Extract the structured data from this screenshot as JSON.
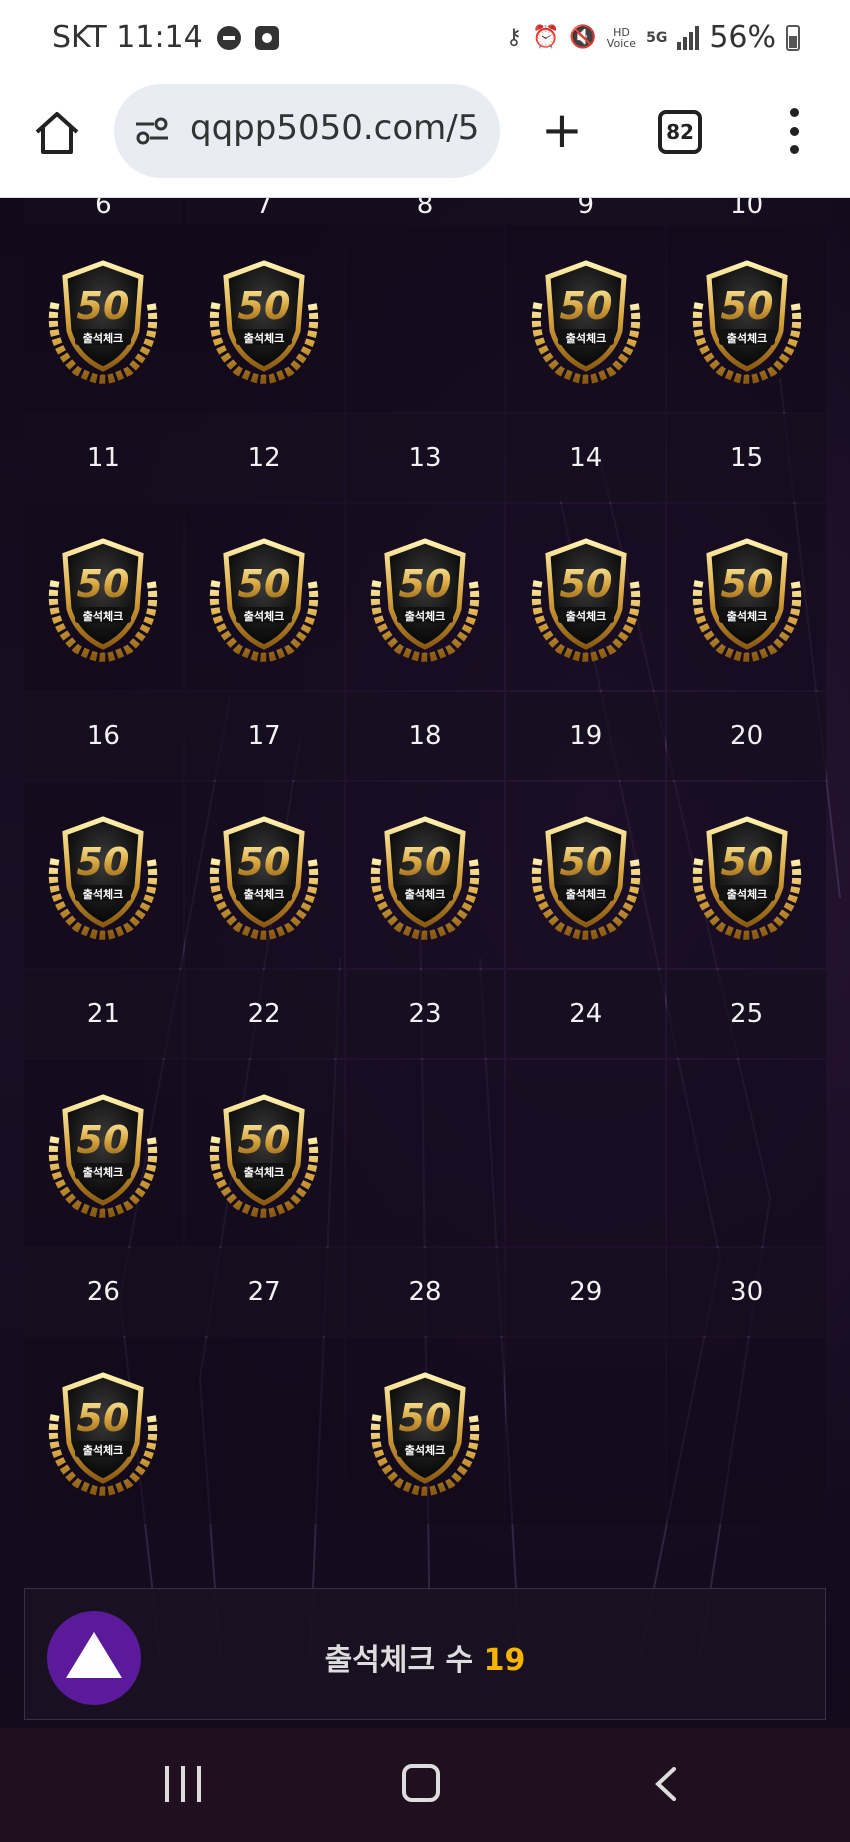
{
  "status_bar": {
    "carrier": "SKT",
    "time": "11:14",
    "battery": "56%",
    "icons": [
      "key-icon",
      "alarm-icon",
      "mute-icon",
      "hd-voice-icon",
      "5g-icon",
      "signal-icon",
      "battery-icon"
    ]
  },
  "browser": {
    "url": "qqpp5050.com/5",
    "tab_count": "82"
  },
  "calendar": {
    "top_partial_days": [
      "6",
      "7",
      "8",
      "9",
      "10"
    ],
    "weeks": [
      {
        "days": [
          "6",
          "7",
          "8",
          "9",
          "10"
        ],
        "checked": [
          true,
          true,
          false,
          true,
          true
        ]
      },
      {
        "days": [
          "11",
          "12",
          "13",
          "14",
          "15"
        ],
        "checked": [
          true,
          true,
          true,
          true,
          true
        ]
      },
      {
        "days": [
          "16",
          "17",
          "18",
          "19",
          "20"
        ],
        "checked": [
          true,
          true,
          true,
          true,
          true
        ]
      },
      {
        "days": [
          "21",
          "22",
          "23",
          "24",
          "25"
        ],
        "checked": [
          true,
          true,
          false,
          false,
          false
        ]
      },
      {
        "days": [
          "26",
          "27",
          "28",
          "29",
          "30"
        ],
        "checked": [
          true,
          false,
          true,
          false,
          false
        ]
      }
    ],
    "badge": {
      "number": "50",
      "text": "출석체크"
    }
  },
  "counter": {
    "label": "출석체크 수",
    "value": "19"
  },
  "colors": {
    "accent": "#f4b400",
    "button": "#5b1a9a",
    "gold": "#d9a740"
  }
}
